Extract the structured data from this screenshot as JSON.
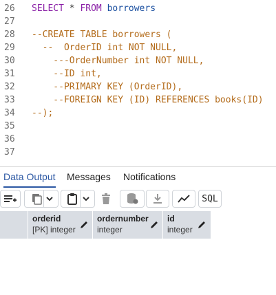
{
  "editor": {
    "lines": [
      {
        "num": "26",
        "parts": [
          {
            "t": "SELECT",
            "c": "kw"
          },
          {
            "t": " * ",
            "c": "plain"
          },
          {
            "t": "FROM",
            "c": "kw"
          },
          {
            "t": " borrowers",
            "c": "id"
          }
        ]
      },
      {
        "num": "27",
        "parts": []
      },
      {
        "num": "28",
        "parts": [
          {
            "t": "--CREATE TABLE borrowers (",
            "c": "cm"
          }
        ]
      },
      {
        "num": "29",
        "parts": [
          {
            "t": "  --  OrderID int NOT NULL,",
            "c": "cm"
          }
        ]
      },
      {
        "num": "30",
        "parts": [
          {
            "t": "    ---OrderNumber int NOT NULL,",
            "c": "cm"
          }
        ]
      },
      {
        "num": "31",
        "parts": [
          {
            "t": "    --ID int,",
            "c": "cm"
          }
        ]
      },
      {
        "num": "32",
        "parts": [
          {
            "t": "    --PRIMARY KEY (OrderID),",
            "c": "cm"
          }
        ]
      },
      {
        "num": "33",
        "parts": [
          {
            "t": "    --FOREIGN KEY (ID) REFERENCES books(ID)",
            "c": "cm"
          }
        ]
      },
      {
        "num": "34",
        "parts": [
          {
            "t": "--);",
            "c": "cm"
          }
        ]
      },
      {
        "num": "35",
        "parts": []
      },
      {
        "num": "36",
        "parts": []
      },
      {
        "num": "37",
        "parts": []
      }
    ]
  },
  "tabs": [
    {
      "label": "Data Output",
      "active": true
    },
    {
      "label": "Messages",
      "active": false
    },
    {
      "label": "Notifications",
      "active": false
    }
  ],
  "toolbar": {
    "sql_label": "SQL"
  },
  "columns": [
    {
      "name": "orderid",
      "type": "[PK] integer"
    },
    {
      "name": "ordernumber",
      "type": "integer"
    },
    {
      "name": "id",
      "type": "integer"
    }
  ],
  "colors": {
    "accent": "#2b57a3",
    "keyword": "#8a1fa6",
    "identifier": "#1a4fa0",
    "comment": "#b36b1a",
    "grid_header": "#d9dde3"
  }
}
